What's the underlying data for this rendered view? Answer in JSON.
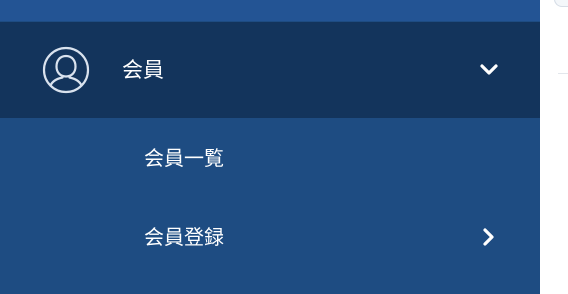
{
  "sidebar": {
    "group": {
      "label": "会員",
      "icon": "user-circle-icon",
      "toggle_icon": "chevron-down-icon",
      "expanded": true
    },
    "items": [
      {
        "label": "会員一覧"
      },
      {
        "label": "会員登録",
        "icon": "chevron-right-icon"
      }
    ]
  },
  "colors": {
    "sidebar_bg": "#1e4c82",
    "top_strip": "#235494",
    "group_header_bg": "#13345c",
    "text": "#ffffff",
    "icon_stroke": "#d9e2ee"
  }
}
